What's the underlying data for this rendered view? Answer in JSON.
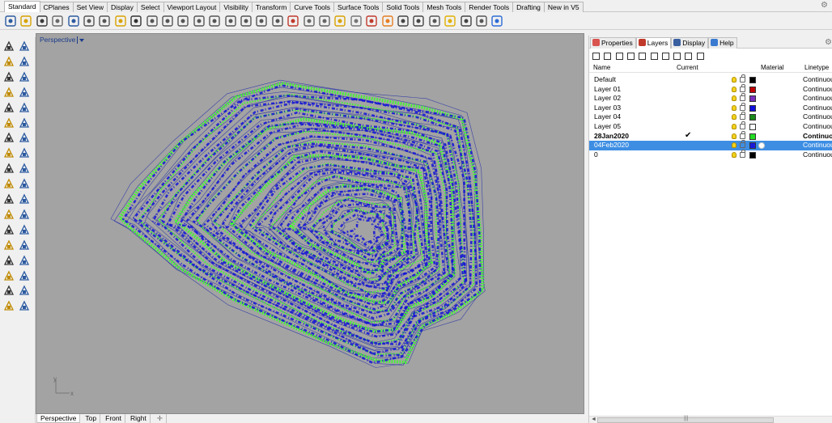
{
  "app": {
    "accent": "#3d8ee3",
    "viewport_bg": "#a3a3a3"
  },
  "ribbon": {
    "tabs": [
      "Standard",
      "CPlanes",
      "Set View",
      "Display",
      "Select",
      "Viewport Layout",
      "Visibility",
      "Transform",
      "Curve Tools",
      "Surface Tools",
      "Solid Tools",
      "Mesh Tools",
      "Render Tools",
      "Drafting",
      "New in V5"
    ],
    "active": "Standard"
  },
  "toolbar_icons": [
    "new-icon",
    "open-icon",
    "save-icon",
    "print-icon",
    "import-icon",
    "cut-icon",
    "copy-icon",
    "paste-icon",
    "undo-icon",
    "pan-icon",
    "rotate-icon",
    "zoom-icon",
    "zoom-window-icon",
    "zoom-extents-icon",
    "zoom-selected-icon",
    "undo-view-icon",
    "viewport-layout-icon",
    "lock-icon",
    "analyze-icon",
    "hide-icon",
    "show-icon",
    "light-icon",
    "lock-objects-icon",
    "layer-icon",
    "color-wheel-icon",
    "render-sphere-icon",
    "render-icon",
    "material-icon",
    "dimension-icon",
    "settings-icon",
    "grid-icon",
    "help-icon"
  ],
  "viewport": {
    "title": "Perspective",
    "axis_x": "x",
    "axis_y": "y"
  },
  "view_tabs": [
    "Perspective",
    "Top",
    "Front",
    "Right"
  ],
  "panel": {
    "tabs": [
      {
        "label": "Properties",
        "icon": "properties-icon",
        "color": "#d9534f"
      },
      {
        "label": "Layers",
        "icon": "layers-icon",
        "color": "#c0392b"
      },
      {
        "label": "Display",
        "icon": "display-icon",
        "color": "#3a5fa0"
      },
      {
        "label": "Help",
        "icon": "help-icon",
        "color": "#3a7ad0"
      }
    ],
    "active_tab": "Layers",
    "tools": [
      "new-layer-icon",
      "new-sublayer-icon",
      "delete-layer-icon",
      "move-up-icon",
      "move-down-icon",
      "move-to-parent-icon",
      "filter-icon",
      "layer-states-icon",
      "tools-icon",
      "help-icon"
    ],
    "columns": {
      "name": "Name",
      "current": "Current",
      "material": "Material",
      "linetype": "Linetype"
    },
    "layers": [
      {
        "name": "Default",
        "color": "#000000",
        "linetype": "Continuous",
        "current": "",
        "bold": false,
        "selected": false
      },
      {
        "name": "Layer 01",
        "color": "#c00000",
        "linetype": "Continuous",
        "current": "",
        "bold": false,
        "selected": false
      },
      {
        "name": "Layer 02",
        "color": "#7b2fbe",
        "linetype": "Continuous",
        "current": "",
        "bold": false,
        "selected": false
      },
      {
        "name": "Layer 03",
        "color": "#1010e0",
        "linetype": "Continuous",
        "current": "",
        "bold": false,
        "selected": false
      },
      {
        "name": "Layer 04",
        "color": "#1a8a1a",
        "linetype": "Continuous",
        "current": "",
        "bold": false,
        "selected": false
      },
      {
        "name": "Layer 05",
        "color": "#ffffff",
        "linetype": "Continuous",
        "current": "",
        "bold": false,
        "selected": false
      },
      {
        "name": "28Jan2020",
        "color": "#22dd22",
        "linetype": "Continuous",
        "current": "✔",
        "bold": true,
        "selected": false
      },
      {
        "name": "04Feb2020",
        "color": "#1a1adc",
        "linetype": "Continuous",
        "current": "",
        "bold": false,
        "selected": true
      },
      {
        "name": "0",
        "color": "#000000",
        "linetype": "Continuous",
        "current": "",
        "bold": false,
        "selected": false
      }
    ]
  },
  "left_tools": [
    "select-icon",
    "point-icon",
    "polyline-icon",
    "curve-icon",
    "circle-icon",
    "arc-icon",
    "polygon-icon",
    "rectangle-icon",
    "ellipse-icon",
    "fillet-icon",
    "surface-icon",
    "surface-edit-icon",
    "box-icon",
    "sphere-icon",
    "extrude-icon",
    "solid-edit-icon",
    "mesh-icon",
    "transform-icon",
    "move-icon",
    "array-icon",
    "boolean-icon",
    "split-icon",
    "trim-icon",
    "extend-icon",
    "text-icon",
    "dimension-icon",
    "group-icon",
    "block-icon",
    "box-edit-icon",
    "align-icon",
    "array-grid-icon",
    "analyze-icon",
    "render-mesh-icon",
    "check-icon",
    "curvature-icon",
    "paint-icon"
  ]
}
